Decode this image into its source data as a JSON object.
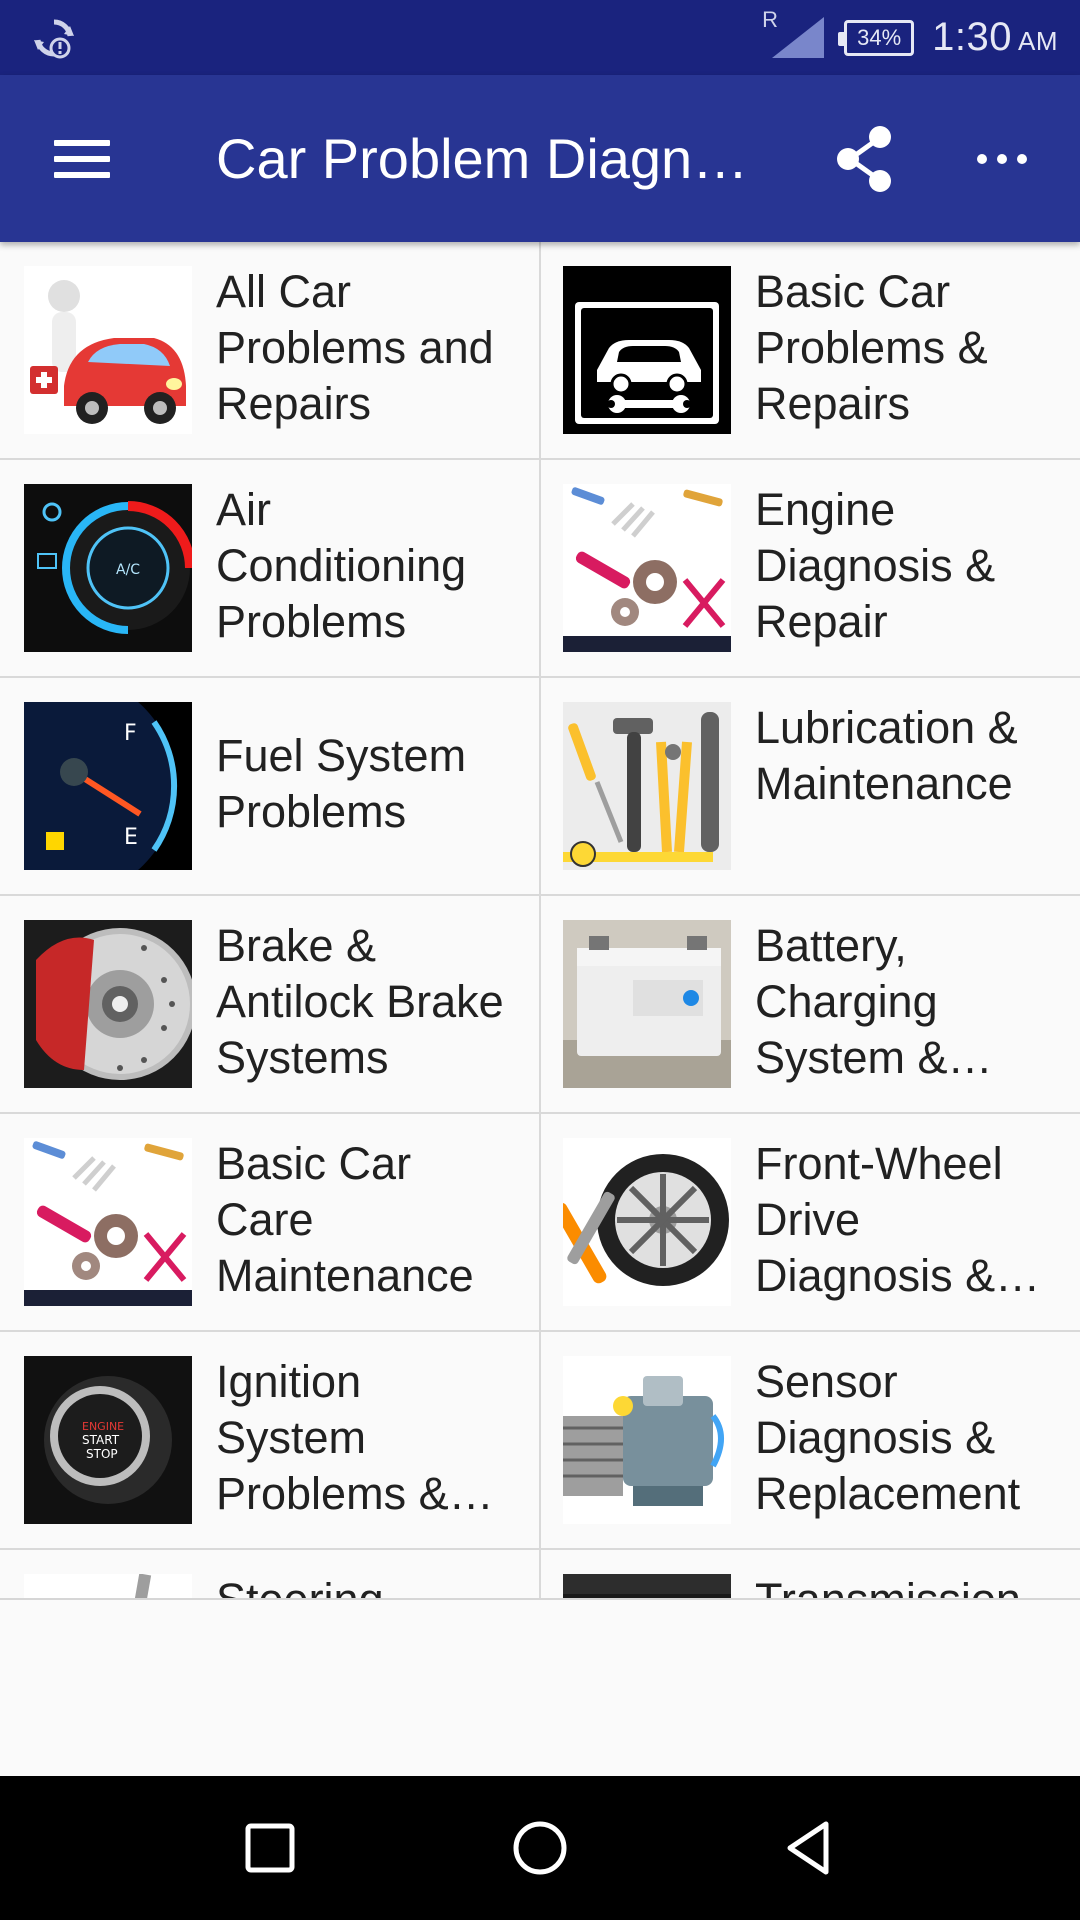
{
  "status_bar": {
    "sync_icon": "sync-alert-icon",
    "signal_label": "R",
    "battery": "34%",
    "time": "1:30",
    "ampm": "AM"
  },
  "app_bar": {
    "title": "Car Problem Diagnosis",
    "menu_icon": "hamburger-menu-icon",
    "share_icon": "share-icon",
    "more_icon": "more-dots-icon"
  },
  "grid": {
    "items": [
      {
        "label": "All Car Problems and Repairs",
        "icon": "cartoon-car-doctor-image"
      },
      {
        "label": "Basic Car Problems & Repairs",
        "icon": "car-repair-sign-image"
      },
      {
        "label": "Air Conditioning Problems",
        "icon": "ac-dial-image"
      },
      {
        "label": "Engine Diagnosis & Repair",
        "icon": "tools-gears-image"
      },
      {
        "label": "Fuel System Problems",
        "icon": "fuel-gauge-image"
      },
      {
        "label": "Lubrication & Maintenance",
        "icon": "hand-tools-image"
      },
      {
        "label": "Brake & Antilock Brake Systems",
        "icon": "brake-disc-image"
      },
      {
        "label": "Battery, Charging System & Starter",
        "icon": "car-battery-image"
      },
      {
        "label": "Basic Car Care Maintenance",
        "icon": "tools-gears-image"
      },
      {
        "label": "Front-Wheel Drive Diagnosis & Repair",
        "icon": "wheel-wrench-image"
      },
      {
        "label": "Ignition System Problems & Repair",
        "icon": "engine-start-button-image"
      },
      {
        "label": "Sensor Diagnosis & Replacement",
        "icon": "engine-block-image"
      },
      {
        "label": "Steering",
        "icon": "steering-tool-image"
      },
      {
        "label": "Transmission",
        "icon": "transmission-image"
      }
    ]
  },
  "nav_bar": {
    "recents_icon": "recents-square-icon",
    "home_icon": "home-circle-icon",
    "back_icon": "back-triangle-icon"
  }
}
